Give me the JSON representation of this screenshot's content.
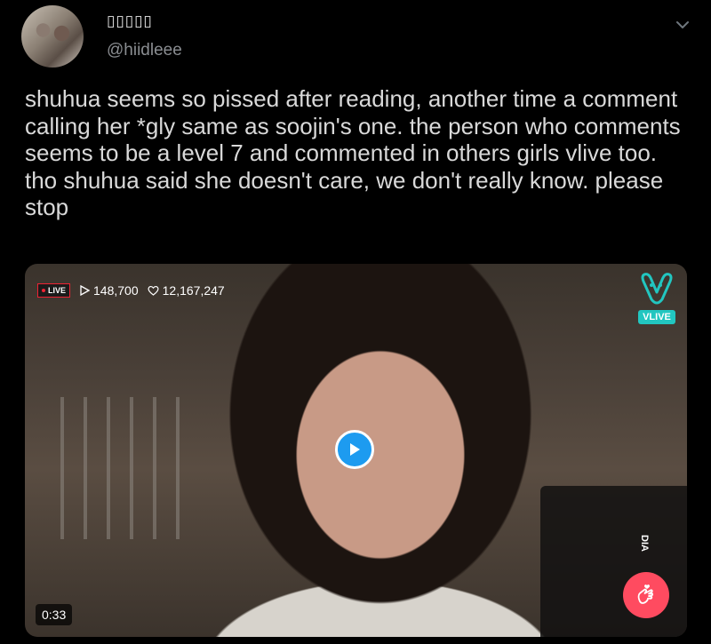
{
  "author": {
    "display_name": "▯▯▯▯▯",
    "handle": "@hiidleee"
  },
  "tweet": {
    "text": "shuhua seems so pissed after reading, another time a comment calling her *gly same as soojin's one. the person who comments seems to be a level 7 and commented in others girls vlive too. tho shuhua said she doesn't care, we don't really know. please stop"
  },
  "media": {
    "live_label": "LIVE",
    "plays": "148,700",
    "hearts": "12,167,247",
    "brand_label": "VLIVE",
    "duration": "0:33",
    "side_text": "DIA",
    "icons": {
      "play": "play-icon",
      "views": "play-count-icon",
      "likes": "heart-outline-icon",
      "more": "chevron-down-icon",
      "reaction": "finger-heart-icon"
    }
  },
  "colors": {
    "background": "#000000",
    "accent": "#1d9bf0",
    "heart_button": "#ff4b60",
    "vlive_teal": "#22c6c0"
  }
}
